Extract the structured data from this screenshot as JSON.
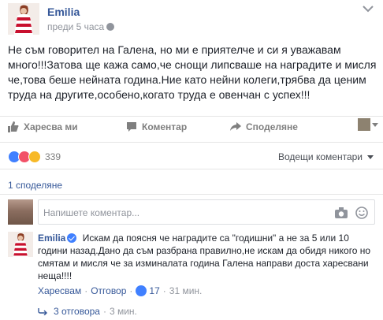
{
  "post": {
    "author": "Emilia",
    "time": "преди 5 часа",
    "text": "Не съм говорител на Галена, но ми е приятелче и си я уважавам много!!!Затова ще кажа само,че снощи липсваше на наградите и мисля че,това беше нейната година.Ние като нейни колеги,трябва да ценим труда на другите,особено,когато труда е овенчан с успех!!!"
  },
  "actions": {
    "like": "Харесва ми",
    "comment": "Коментар",
    "share": "Споделяне"
  },
  "reactions": {
    "count": "339",
    "sort_label": "Водещи коментари",
    "colors": {
      "like": "#4080ff",
      "love": "#f25268",
      "haha": "#f7b928"
    }
  },
  "shares": {
    "label": "1 споделяне"
  },
  "composer": {
    "placeholder": "Напишете коментар..."
  },
  "comment": {
    "author": "Emilia",
    "text": "Искам да поясня че наградите са \"годишни\" а не за 5 или 10 години назад.Дано да съм разбрана правилно,не искам да обидя никого но смятам и мисля че за изминалата година Галена направи доста харесвани неща!!!!",
    "like_label": "Харесвам",
    "reply_label": "Отговор",
    "likes": "17",
    "time": "31 мин."
  },
  "replies": {
    "label": "3 отговора",
    "time": "3 мин."
  },
  "icons": {
    "globe": "globe-icon",
    "chevron": "chevron-down-icon",
    "like": "thumbs-up-icon",
    "comment": "comment-bubble-icon",
    "share": "share-arrow-icon",
    "camera": "camera-icon",
    "smile": "smiley-icon",
    "reply_arrow": "reply-arrow-icon"
  }
}
